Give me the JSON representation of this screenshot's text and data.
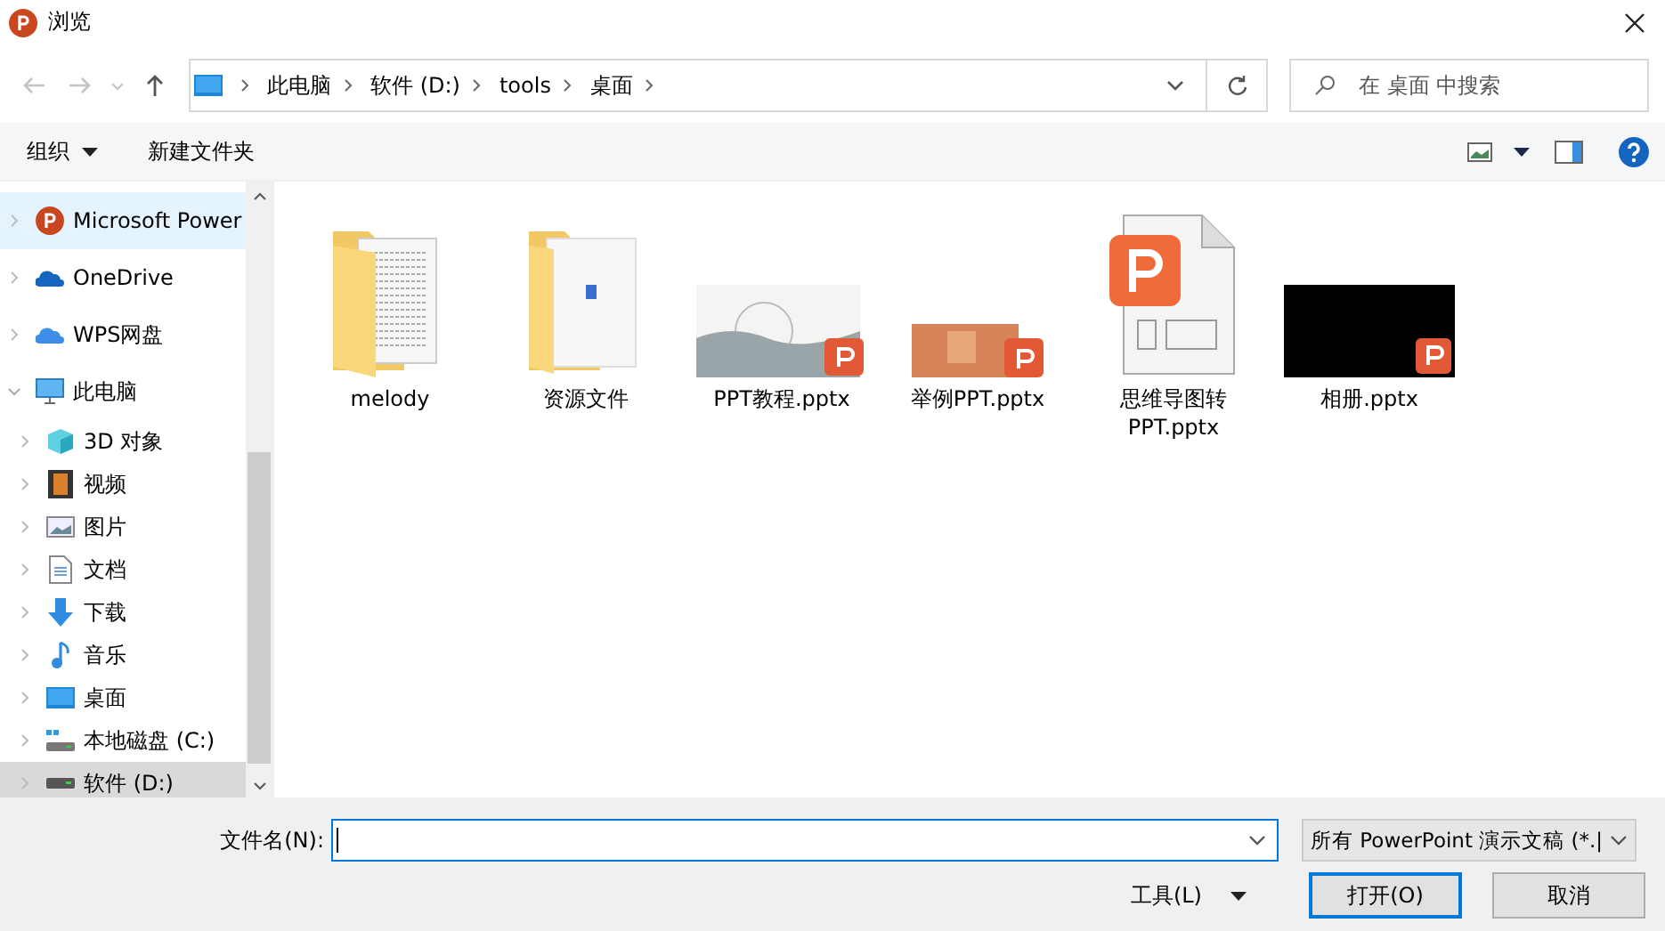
{
  "window": {
    "title": "浏览"
  },
  "address_bar": {
    "path": [
      "此电脑",
      "软件 (D:)",
      "tools",
      "桌面"
    ]
  },
  "search": {
    "placeholder": "在 桌面 中搜索"
  },
  "toolbar": {
    "organize": "组织",
    "new_folder": "新建文件夹"
  },
  "sidebar": {
    "items": [
      {
        "label": "Microsoft Power",
        "kind": "ppt",
        "selected": false,
        "hovered": true
      },
      {
        "label": "OneDrive",
        "kind": "onedrive",
        "selected": false,
        "hovered": false
      },
      {
        "label": "WPS网盘",
        "kind": "cloud",
        "selected": false,
        "hovered": false
      },
      {
        "label": "此电脑",
        "kind": "pc",
        "selected": false,
        "hovered": false,
        "expanded": true,
        "children": [
          {
            "label": "3D 对象",
            "kind": "cube",
            "selected": false,
            "hovered": false
          },
          {
            "label": "视频",
            "kind": "video",
            "selected": false,
            "hovered": false
          },
          {
            "label": "图片",
            "kind": "pictures",
            "selected": false,
            "hovered": false
          },
          {
            "label": "文档",
            "kind": "docs",
            "selected": false,
            "hovered": false
          },
          {
            "label": "下载",
            "kind": "download",
            "selected": false,
            "hovered": false
          },
          {
            "label": "音乐",
            "kind": "music",
            "selected": false,
            "hovered": false
          },
          {
            "label": "桌面",
            "kind": "desktop",
            "selected": false,
            "hovered": false
          },
          {
            "label": "本地磁盘 (C:)",
            "kind": "system-drive",
            "selected": false,
            "hovered": false
          },
          {
            "label": "软件 (D:)",
            "kind": "drive",
            "selected": true,
            "hovered": false
          }
        ]
      }
    ]
  },
  "files": [
    {
      "name": "melody",
      "kind": "folder-docs"
    },
    {
      "name": "资源文件",
      "kind": "folder-file"
    },
    {
      "name": "PPT教程.pptx",
      "kind": "thumb-landscape"
    },
    {
      "name": "举例PPT.pptx",
      "kind": "thumb-orange"
    },
    {
      "name": "思维导图转PPT.pptx",
      "kind": "ppt-file"
    },
    {
      "name": "相册.pptx",
      "kind": "thumb-dark"
    }
  ],
  "footer": {
    "filename_label": "文件名(N):",
    "filter": "所有 PowerPoint 演示文稿 (*.|",
    "tools": "工具(L)",
    "open": "打开(O)",
    "cancel": "取消"
  }
}
